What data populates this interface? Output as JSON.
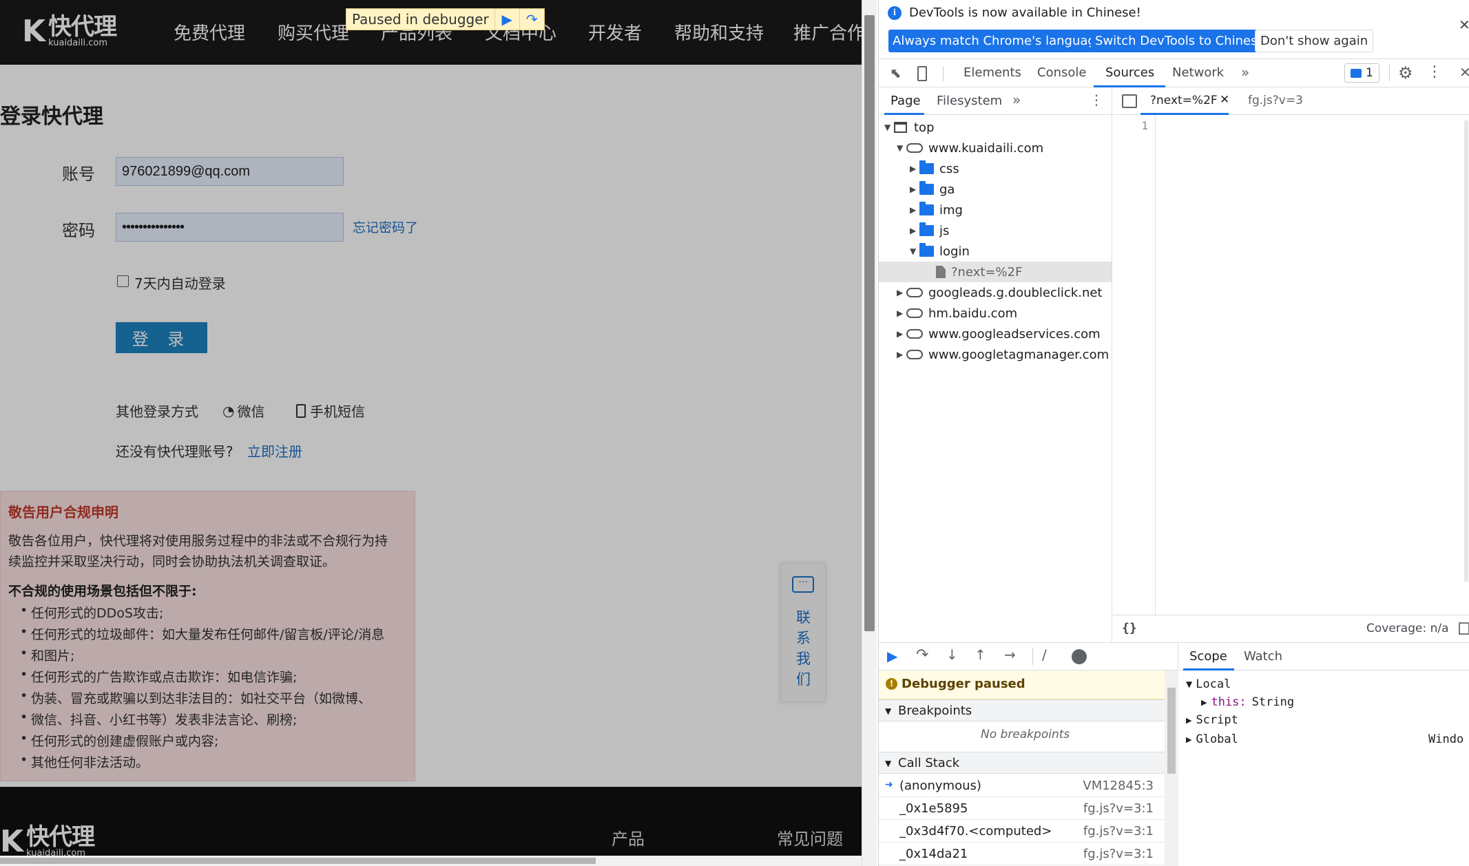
{
  "site": {
    "header": {
      "logo_cn": "快代理",
      "logo_en": "kuaidaili.com",
      "nav": [
        "免费代理",
        "购买代理",
        "产品列表",
        "文档中心",
        "开发者",
        "帮助和支持",
        "推广合作"
      ],
      "paused_label": "Paused in debugger"
    },
    "login": {
      "title": "登录快代理",
      "account_label": "账号",
      "account_value": "976021899@qq.com",
      "password_label": "密码",
      "password_value": "•••••••••••••••",
      "forgot": "忘记密码了",
      "remember": "7天内自动登录",
      "submit": "登 录",
      "other_login": "其他登录方式",
      "wechat": "微信",
      "sms": "手机短信",
      "no_account": "还没有快代理账号?",
      "register": "立即注册"
    },
    "notice": {
      "title": "敬告用户合规申明",
      "line1": "敬告各位用户，快代理将对使用服务过程中的非法或不合规行为持",
      "line2": "续监控并采取坚决行动，同时会协助执法机关调查取证。",
      "subtitle": "不合规的使用场景包括但不限于:",
      "items": [
        "任何形式的DDoS攻击;",
        "任何形式的垃圾邮件：如大量发布任何邮件/留言板/评论/消息",
        "和图片;",
        "任何形式的广告欺诈或点击欺诈：如电信诈骗;",
        "伪装、冒充或欺骗以到达非法目的：如社交平台（如微博、",
        "微信、抖音、小红书等）发表非法言论、刷榜;",
        "任何形式的创建虚假账户或内容;",
        "其他任何非法活动。"
      ]
    },
    "contact": [
      "联",
      "系",
      "我",
      "们"
    ],
    "footer": {
      "logo_cn": "快代理",
      "logo_en": "kuaidaili.com",
      "links": [
        "产品",
        "常见问题"
      ]
    }
  },
  "devtools": {
    "info": {
      "message": "DevTools is now available in Chinese!",
      "btn_match": "Always match Chrome's language",
      "btn_switch": "Switch DevTools to Chinese",
      "btn_dismiss": "Don't show again"
    },
    "tabs": [
      "Elements",
      "Console",
      "Sources",
      "Network"
    ],
    "issues_count": "1",
    "navigator": {
      "subtabs": [
        "Page",
        "Filesystem"
      ],
      "tree": {
        "top": "top",
        "domain": "www.kuaidaili.com",
        "folders": [
          "css",
          "ga",
          "img",
          "js",
          "login"
        ],
        "file": "?next=%2F",
        "other_domains": [
          "googleads.g.doubleclick.net",
          "hm.baidu.com",
          "www.googleadservices.com",
          "www.googletagmanager.com"
        ]
      }
    },
    "editor": {
      "tabs": [
        "?next=%2F",
        "fg.js?v=3"
      ],
      "line_number": "1",
      "format_icon": "{}",
      "coverage": "Coverage: n/a"
    },
    "debugger": {
      "paused": "Debugger paused",
      "breakpoints_title": "Breakpoints",
      "no_breakpoints": "No breakpoints",
      "callstack_title": "Call Stack",
      "stack": [
        {
          "fn": "(anonymous)",
          "loc": "VM12845:3"
        },
        {
          "fn": "_0x1e5895",
          "loc": "fg.js?v=3:1"
        },
        {
          "fn": "_0x3d4f70.<computed>",
          "loc": "fg.js?v=3:1"
        },
        {
          "fn": "_0x14da21",
          "loc": "fg.js?v=3:1"
        }
      ]
    },
    "scope": {
      "tabs": [
        "Scope",
        "Watch"
      ],
      "local": "Local",
      "this_key": "this:",
      "this_val": "String",
      "script": "Script",
      "global": "Global",
      "global_val": "Windo"
    }
  }
}
